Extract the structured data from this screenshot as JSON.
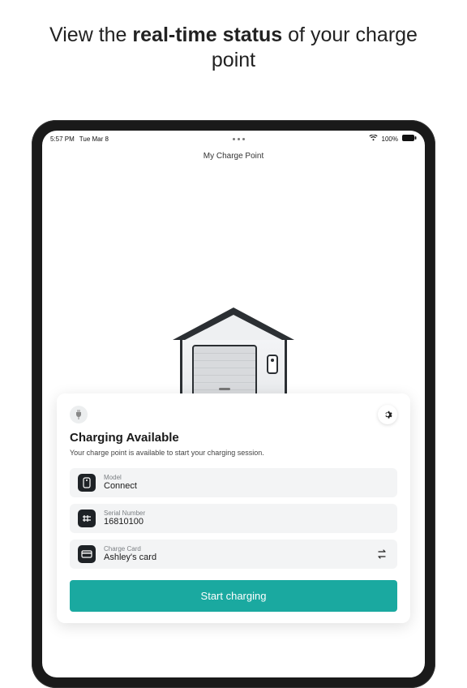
{
  "promo": {
    "prefix": "View the ",
    "bold": "real-time status",
    "suffix": " of your charge point"
  },
  "statusbar": {
    "time": "5:57 PM",
    "date": "Tue Mar 8",
    "battery": "100%"
  },
  "header": {
    "title": "My Charge Point"
  },
  "card": {
    "title": "Charging Available",
    "subtitle": "Your charge point is available to start your charging session.",
    "rows": [
      {
        "label": "Model",
        "value": "Connect"
      },
      {
        "label": "Serial Number",
        "value": "16810100"
      },
      {
        "label": "Charge Card",
        "value": "Ashley's card"
      }
    ],
    "cta": "Start charging"
  }
}
